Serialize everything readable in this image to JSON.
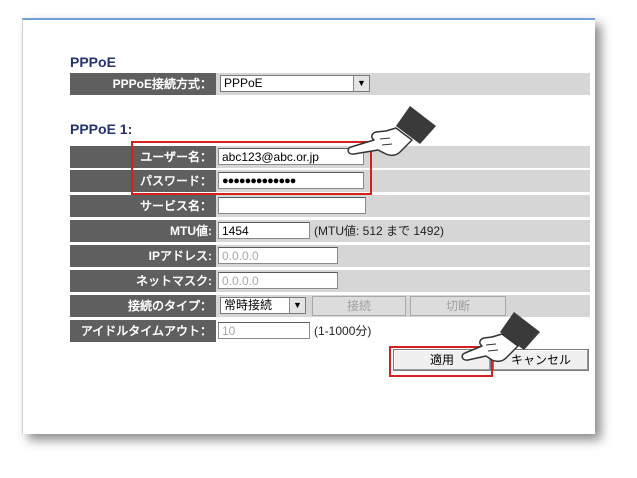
{
  "pppoe": {
    "title": "PPPoE",
    "method_label": "PPPoE接続方式：",
    "method_value": "PPPoE"
  },
  "pppoe1": {
    "title": "PPPoE 1:",
    "username_label": "ユーザー名：",
    "username_value": "abc123@abc.or.jp",
    "password_label": "パスワード：",
    "password_value": "●●●●●●●●●●●●●",
    "service_label": "サービス名：",
    "service_value": "",
    "mtu_label": "MTU値:",
    "mtu_value": "1454",
    "mtu_hint": "(MTU値: 512 まで  1492)",
    "ip_label": "IPアドレス:",
    "ip_value": "0.0.0.0",
    "netmask_label": "ネットマスク:",
    "netmask_value": "0.0.0.0",
    "conn_type_label": "接続のタイプ：",
    "conn_type_value": "常時接続",
    "connect_label": "接続",
    "disconnect_label": "切断",
    "idle_label": "アイドルタイムアウト：",
    "idle_value": "10",
    "idle_hint": "(1-1000分)"
  },
  "buttons": {
    "apply": "適用",
    "cancel": "キャンセル"
  },
  "colors": {
    "label_bg": "#5f5f5f",
    "field_bg": "#d6d6d6",
    "title": "#23346e",
    "highlight": "#d42020"
  }
}
